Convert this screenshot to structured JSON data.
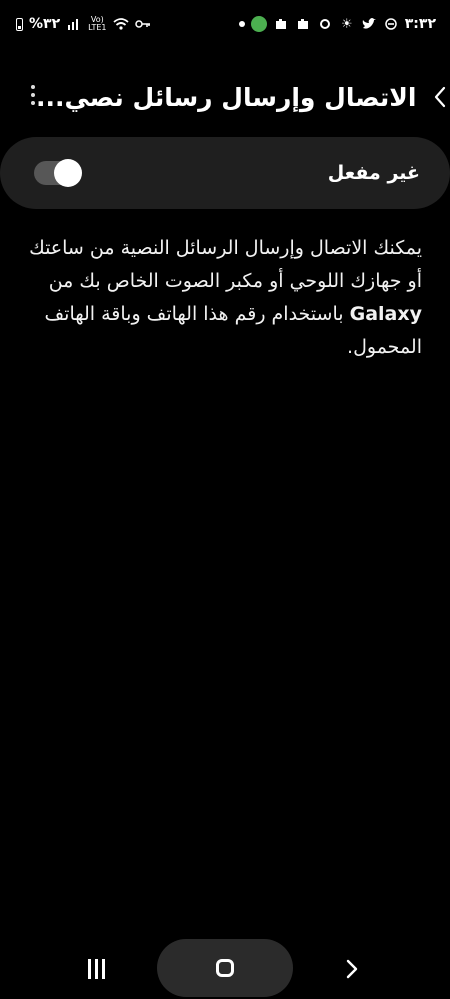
{
  "status_bar": {
    "time": "٣:٣٢",
    "battery_percent": "%٣٢",
    "network_label_top": "Vo)",
    "network_label_bottom": "LTE1"
  },
  "header": {
    "title": "الاتصال وإرسال رسائل نصي...",
    "back_icon": "chevron-back-icon",
    "more_icon": "more-vertical-icon"
  },
  "toggle": {
    "label": "غير مفعل",
    "state": "off"
  },
  "description": {
    "part1": "يمكنك الاتصال وإرسال الرسائل النصية من ساعتك أو جهازك اللوحي أو مكبر الصوت الخاص بك من ",
    "brand": "Galaxy",
    "part2": " باستخدام رقم هذا الهاتف وباقة الهاتف المحمول."
  },
  "nav": {
    "recents_icon": "recents-icon",
    "home_icon": "home-icon",
    "back_icon": "back-arrow-icon"
  }
}
